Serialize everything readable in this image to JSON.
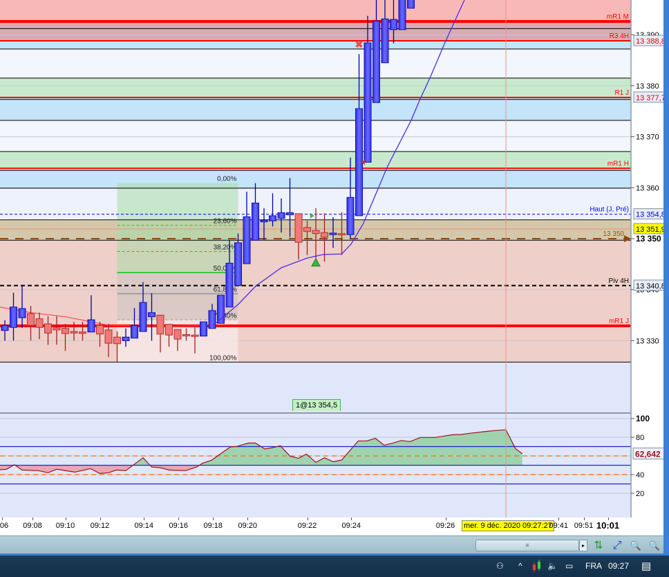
{
  "chart_data": {
    "type": "candlestick",
    "price_axis": {
      "ticks": [
        {
          "value": 13390,
          "label": "13 390"
        },
        {
          "value": 13380,
          "label": "13 380"
        },
        {
          "value": 13370,
          "label": "13 370"
        },
        {
          "value": 13360,
          "label": "13 360"
        },
        {
          "value": 13350,
          "label": "13 350",
          "bold": true
        },
        {
          "value": 13340,
          "label": "13 340"
        },
        {
          "value": 13330,
          "label": "13 330"
        }
      ],
      "range": [
        13320,
        13397
      ]
    },
    "time_axis": {
      "ticks": [
        {
          "bar": -0.3,
          "label": "06"
        },
        {
          "bar": 3.2,
          "label": "09:08"
        },
        {
          "bar": 7,
          "label": "09:10"
        },
        {
          "bar": 11,
          "label": "09:12"
        },
        {
          "bar": 16.1,
          "label": "09:14"
        },
        {
          "bar": 20.1,
          "label": "09:16"
        },
        {
          "bar": 24.1,
          "label": "09:18"
        },
        {
          "bar": 28.1,
          "label": "09:20"
        },
        {
          "bar": 35,
          "label": "09:22"
        },
        {
          "bar": 40.1,
          "label": "09:24"
        },
        {
          "bar": 51,
          "label": "09:26"
        },
        {
          "bar": 64.1,
          "label": "09:41"
        },
        {
          "bar": 67,
          "label": "09:51"
        },
        {
          "bar": 69.8,
          "label": "10:01",
          "bold": true
        }
      ],
      "crosshair_label": "mer. 9 déc. 2020 09:27:27",
      "crosshair_bar": 58
    },
    "candles_ohlc": [
      [
        13332,
        13334,
        13330,
        13333
      ],
      [
        13332.6,
        13339.4,
        13330,
        13336.6
      ],
      [
        13334.5,
        13340.8,
        13332.5,
        13336.3
      ],
      [
        13335.3,
        13336.8,
        13330,
        13333
      ],
      [
        13334.3,
        13335.5,
        13330.3,
        13332.6
      ],
      [
        13333.3,
        13334.8,
        13329.2,
        13331.5
      ],
      [
        13332.5,
        13334.8,
        13329.2,
        13332.1
      ],
      [
        13332.4,
        13333.3,
        13328,
        13331.4
      ],
      [
        13331.8,
        13333.7,
        13330,
        13331.5
      ],
      [
        13331.7,
        13333.7,
        13330,
        13331.6
      ],
      [
        13331.7,
        13338.9,
        13331.7,
        13334.1
      ],
      [
        13333,
        13333.7,
        13328.8,
        13331.3
      ],
      [
        13332.1,
        13333.3,
        13326.8,
        13329.5
      ],
      [
        13330.7,
        13331.8,
        13325.8,
        13329.4
      ],
      [
        13330,
        13332.4,
        13328.8,
        13330.7
      ],
      [
        13330.5,
        13336.4,
        13330.5,
        13333
      ],
      [
        13331.8,
        13341.5,
        13331.8,
        13337.5
      ],
      [
        13334.7,
        13339.3,
        13330,
        13335.5
      ],
      [
        13335,
        13335,
        13327.7,
        13331.3
      ],
      [
        13333.2,
        13333.2,
        13328.8,
        13331.1
      ],
      [
        13332.2,
        13332.2,
        13328,
        13330.3
      ],
      [
        13331.2,
        13332.4,
        13330,
        13331
      ],
      [
        13331.1,
        13332.6,
        13327.5,
        13330.9
      ],
      [
        13330.9,
        13333.7,
        13330.9,
        13333.7
      ],
      [
        13332.4,
        13337.2,
        13332.4,
        13335.9
      ],
      [
        13333.4,
        13338.9,
        13333.4,
        13338.9
      ],
      [
        13336.6,
        13349.7,
        13336.6,
        13345.2
      ],
      [
        13340.8,
        13351,
        13340.8,
        13349.2
      ],
      [
        13345.1,
        13359.2,
        13345.1,
        13354.3
      ],
      [
        13349.7,
        13360.9,
        13349.7,
        13357
      ],
      [
        13353.3,
        13356,
        13349.7,
        13353.6
      ],
      [
        13353.5,
        13358.9,
        13352.4,
        13354.5
      ],
      [
        13354,
        13357.9,
        13351.2,
        13355.1
      ],
      [
        13354.7,
        13361.9,
        13350.3,
        13355.1
      ],
      [
        13354.9,
        13354.9,
        13345.9,
        13349.3
      ],
      [
        13352.2,
        13353.5,
        13346.8,
        13351.4
      ],
      [
        13351.6,
        13356,
        13345.8,
        13351
      ],
      [
        13351.2,
        13355,
        13345.5,
        13350.3
      ],
      [
        13350.8,
        13354.2,
        13348.2,
        13351.1
      ],
      [
        13351,
        13355.2,
        13346.8,
        13350.9
      ],
      [
        13350.8,
        13365.9,
        13350,
        13358.1
      ],
      [
        13354.5,
        13386.2,
        13354.5,
        13375.5
      ],
      [
        13365,
        13393.7,
        13365,
        13388.4
      ],
      [
        13376.7,
        13400,
        13376.7,
        13392.7
      ],
      [
        13384.5,
        13400,
        13384.5,
        13393.1
      ],
      [
        13391,
        13400,
        13388.3,
        13393
      ],
      [
        13391,
        13402,
        13391,
        13402
      ],
      [
        13395.2,
        13402,
        13395.2,
        13402
      ]
    ],
    "ma_red": [
      [
        -0.6,
        13336.6
      ],
      [
        3,
        13335.5
      ],
      [
        7,
        13334.7
      ],
      [
        12.1,
        13333
      ],
      [
        19,
        13332.8
      ],
      [
        24.1,
        13333
      ]
    ],
    "ma_blue": [
      [
        24.1,
        13333
      ],
      [
        27,
        13337.1
      ],
      [
        29.1,
        13340.8
      ],
      [
        32,
        13344.3
      ],
      [
        35,
        13346.2
      ],
      [
        36.9,
        13346.9
      ],
      [
        39,
        13347
      ],
      [
        40.1,
        13349
      ],
      [
        41.5,
        13353
      ],
      [
        44.3,
        13364.2
      ],
      [
        47,
        13373.1
      ],
      [
        48.1,
        13377.5
      ],
      [
        49.3,
        13381.9
      ],
      [
        50.9,
        13388.3
      ],
      [
        53.2,
        13396.8
      ]
    ],
    "zones": [
      {
        "from": 13392.8,
        "to": 13400,
        "color": "#f9b8b8"
      },
      {
        "from": 13388.8,
        "to": 13392.4,
        "color": "#d8aab4"
      },
      {
        "from": 13387.2,
        "to": 13388.8,
        "color": "#c4e4fa"
      },
      {
        "from": 13381.5,
        "to": 13387.2,
        "color": "#f3f6fd"
      },
      {
        "from": 13377.5,
        "to": 13381.5,
        "color": "#c8eacc"
      },
      {
        "from": 13373.2,
        "to": 13377.5,
        "color": "#c4e4fa"
      },
      {
        "from": 13367.1,
        "to": 13373.2,
        "color": "#f3f6fd"
      },
      {
        "from": 13363.6,
        "to": 13367.1,
        "color": "#c8eacc"
      },
      {
        "from": 13359.9,
        "to": 13363.6,
        "color": "#c4e4fa"
      },
      {
        "from": 13353.6,
        "to": 13359.9,
        "color": "#eef2fd"
      },
      {
        "from": 13349.7,
        "to": 13353.6,
        "color": "#d5c8a8"
      },
      {
        "from": 13325.8,
        "to": 13349.7,
        "color": "#efcfc9"
      },
      {
        "from": 13310,
        "to": 13325.8,
        "color": "#e0e7fa"
      }
    ],
    "levels": [
      {
        "price": 13392.6,
        "color": "#ff0000",
        "width": 4,
        "label": "mR1 M"
      },
      {
        "price": 13391.2,
        "color": "#000000",
        "width": 1
      },
      {
        "price": 13388.8,
        "color": "#ff0000",
        "width": 2,
        "label": "R3 4H",
        "axis": "13 388,8",
        "axis_color": "#e00000"
      },
      {
        "price": 13387.2,
        "color": "#000000",
        "width": 1
      },
      {
        "price": 13381.5,
        "color": "#000000",
        "width": 1
      },
      {
        "price": 13377.7,
        "color": "#ff0000",
        "width": 2,
        "label": "R1 J",
        "axis": "13 377,7",
        "axis_color": "#e00000"
      },
      {
        "price": 13377.3,
        "color": "#000000",
        "width": 1
      },
      {
        "price": 13373.2,
        "color": "#000000",
        "width": 1
      },
      {
        "price": 13367.1,
        "color": "#000000",
        "width": 1
      },
      {
        "price": 13363.8,
        "color": "#ff0000",
        "width": 2,
        "label": "mR1 H"
      },
      {
        "price": 13363.4,
        "color": "#000000",
        "width": 1
      },
      {
        "price": 13359.9,
        "color": "#000000",
        "width": 1
      },
      {
        "price": 13354.8,
        "color": "#0000ff",
        "width": 1,
        "dash": "4,3",
        "label": "Haut (J, Pré)",
        "axis": "13 354,8",
        "axis_color": "#0000cc"
      },
      {
        "price": 13353.7,
        "color": "#000000",
        "width": 1
      },
      {
        "price": 13351.9,
        "color": "#e89090",
        "width": 1,
        "axis": "13 351,9",
        "axis_color": "#000000",
        "axis_bg": "#ffff00"
      },
      {
        "price": 13350,
        "color": "#8b4a10",
        "width": 2,
        "dash": "12,10",
        "label": "13 350"
      },
      {
        "price": 13349.7,
        "color": "#000000",
        "width": 1
      },
      {
        "price": 13340.8,
        "color": "#000000",
        "width": 2,
        "dash": "6,4",
        "label": "Piv 4H",
        "axis": "13 340,8",
        "axis_color": "#000000"
      },
      {
        "price": 13332.9,
        "color": "#ff0000",
        "width": 4,
        "label": "mR1 J"
      },
      {
        "price": 13325.8,
        "color": "#000000",
        "width": 1
      }
    ],
    "fibonacci": {
      "from_bar": 13,
      "to_bar": 27,
      "high": 13360.9,
      "low": 13325.8,
      "levels": [
        {
          "ratio": 0,
          "label": "0,00%"
        },
        {
          "ratio": 0.236,
          "label": "23,60%"
        },
        {
          "ratio": 0.382,
          "label": "38,20%"
        },
        {
          "ratio": 0.5,
          "label": "50,00%"
        },
        {
          "ratio": 0.618,
          "label": "61,80%"
        },
        {
          "ratio": 0.764,
          "label": "76,40%"
        },
        {
          "ratio": 1,
          "label": "100,00%"
        }
      ]
    },
    "markers": [
      {
        "type": "buy-triangle",
        "bar": 36,
        "price": 13345.3,
        "color": "#3cb44b"
      },
      {
        "type": "flag",
        "bar": 35.5,
        "price": 13354.5,
        "color": "#3cb44b"
      },
      {
        "type": "exit-cross",
        "bar": 41,
        "price": 13388.1,
        "color": "#e05050"
      },
      {
        "type": "small-triangle",
        "bar": 41.5,
        "price": 13365,
        "color": "#d03030"
      }
    ],
    "trade_label": "1@13 354,5",
    "oscillator": {
      "ticks": [
        {
          "value": 100,
          "label": "100",
          "bold": true
        },
        {
          "value": 80,
          "label": "80"
        },
        {
          "value": 40,
          "label": "40"
        },
        {
          "value": 20,
          "label": "20"
        }
      ],
      "bands": [
        {
          "value": 70,
          "color": "#2020d0"
        },
        {
          "value": 50,
          "color": "#2020d0"
        },
        {
          "value": 30,
          "color": "#2020d0"
        }
      ],
      "dashed": [
        {
          "value": 60,
          "color": "#ff6a00"
        },
        {
          "value": 40,
          "color": "#ff6a00"
        }
      ],
      "baseline": 50,
      "current": "62,642",
      "points": [
        [
          -0.6,
          45.2
        ],
        [
          0.2,
          45.7
        ],
        [
          1.1,
          50.6
        ],
        [
          2,
          44.9
        ],
        [
          3.9,
          44.2
        ],
        [
          5,
          42
        ],
        [
          6,
          45.7
        ],
        [
          8.1,
          42.7
        ],
        [
          9.9,
          46.4
        ],
        [
          11,
          41.2
        ],
        [
          12,
          42
        ],
        [
          12.9,
          44.9
        ],
        [
          14,
          44.2
        ],
        [
          16,
          58
        ],
        [
          17,
          48.1
        ],
        [
          18,
          47.4
        ],
        [
          19,
          44.9
        ],
        [
          20.9,
          44.2
        ],
        [
          22.2,
          48.1
        ],
        [
          22.9,
          52.3
        ],
        [
          23.9,
          55.3
        ],
        [
          26.1,
          69.6
        ],
        [
          26.8,
          70.1
        ],
        [
          28.2,
          73.8
        ],
        [
          29,
          73.8
        ],
        [
          30.1,
          67.4
        ],
        [
          31,
          68.9
        ],
        [
          31.9,
          70.9
        ],
        [
          33,
          59.8
        ],
        [
          34,
          57.5
        ],
        [
          34.9,
          62
        ],
        [
          36,
          53.1
        ],
        [
          37,
          58
        ],
        [
          38,
          53.8
        ],
        [
          39,
          55.6
        ],
        [
          40.9,
          76.1
        ],
        [
          41.9,
          76.1
        ],
        [
          42.9,
          78.8
        ],
        [
          43.9,
          71.4
        ],
        [
          44.9,
          73.8
        ],
        [
          45.9,
          76.5
        ],
        [
          46.9,
          75.3
        ],
        [
          48.1,
          79.8
        ],
        [
          49.8,
          79.8
        ],
        [
          51.8,
          82.7
        ],
        [
          52.8,
          83
        ],
        [
          53.8,
          84.2
        ],
        [
          55.7,
          86.2
        ],
        [
          56.7,
          87.2
        ],
        [
          58,
          88
        ],
        [
          59.1,
          67.9
        ],
        [
          59.9,
          62.3
        ]
      ]
    }
  },
  "toolbar": {
    "scroll_grip": "≡",
    "scroll_arrow": "▸",
    "tools": [
      {
        "name": "auto-scale-icon",
        "glyph": "⇅"
      },
      {
        "name": "zoom-fit-icon",
        "glyph": "⤢"
      },
      {
        "name": "zoom-out-icon",
        "glyph": "🔍"
      },
      {
        "name": "zoom-in-icon",
        "glyph": "🔍"
      }
    ]
  },
  "taskbar": {
    "language": "FRA",
    "time": "09:27"
  },
  "colors": {
    "candle_up": "#4b4bf5",
    "candle_up_border": "#1010b0",
    "candle_down": "#f07878",
    "candle_down_border": "#b03030"
  }
}
